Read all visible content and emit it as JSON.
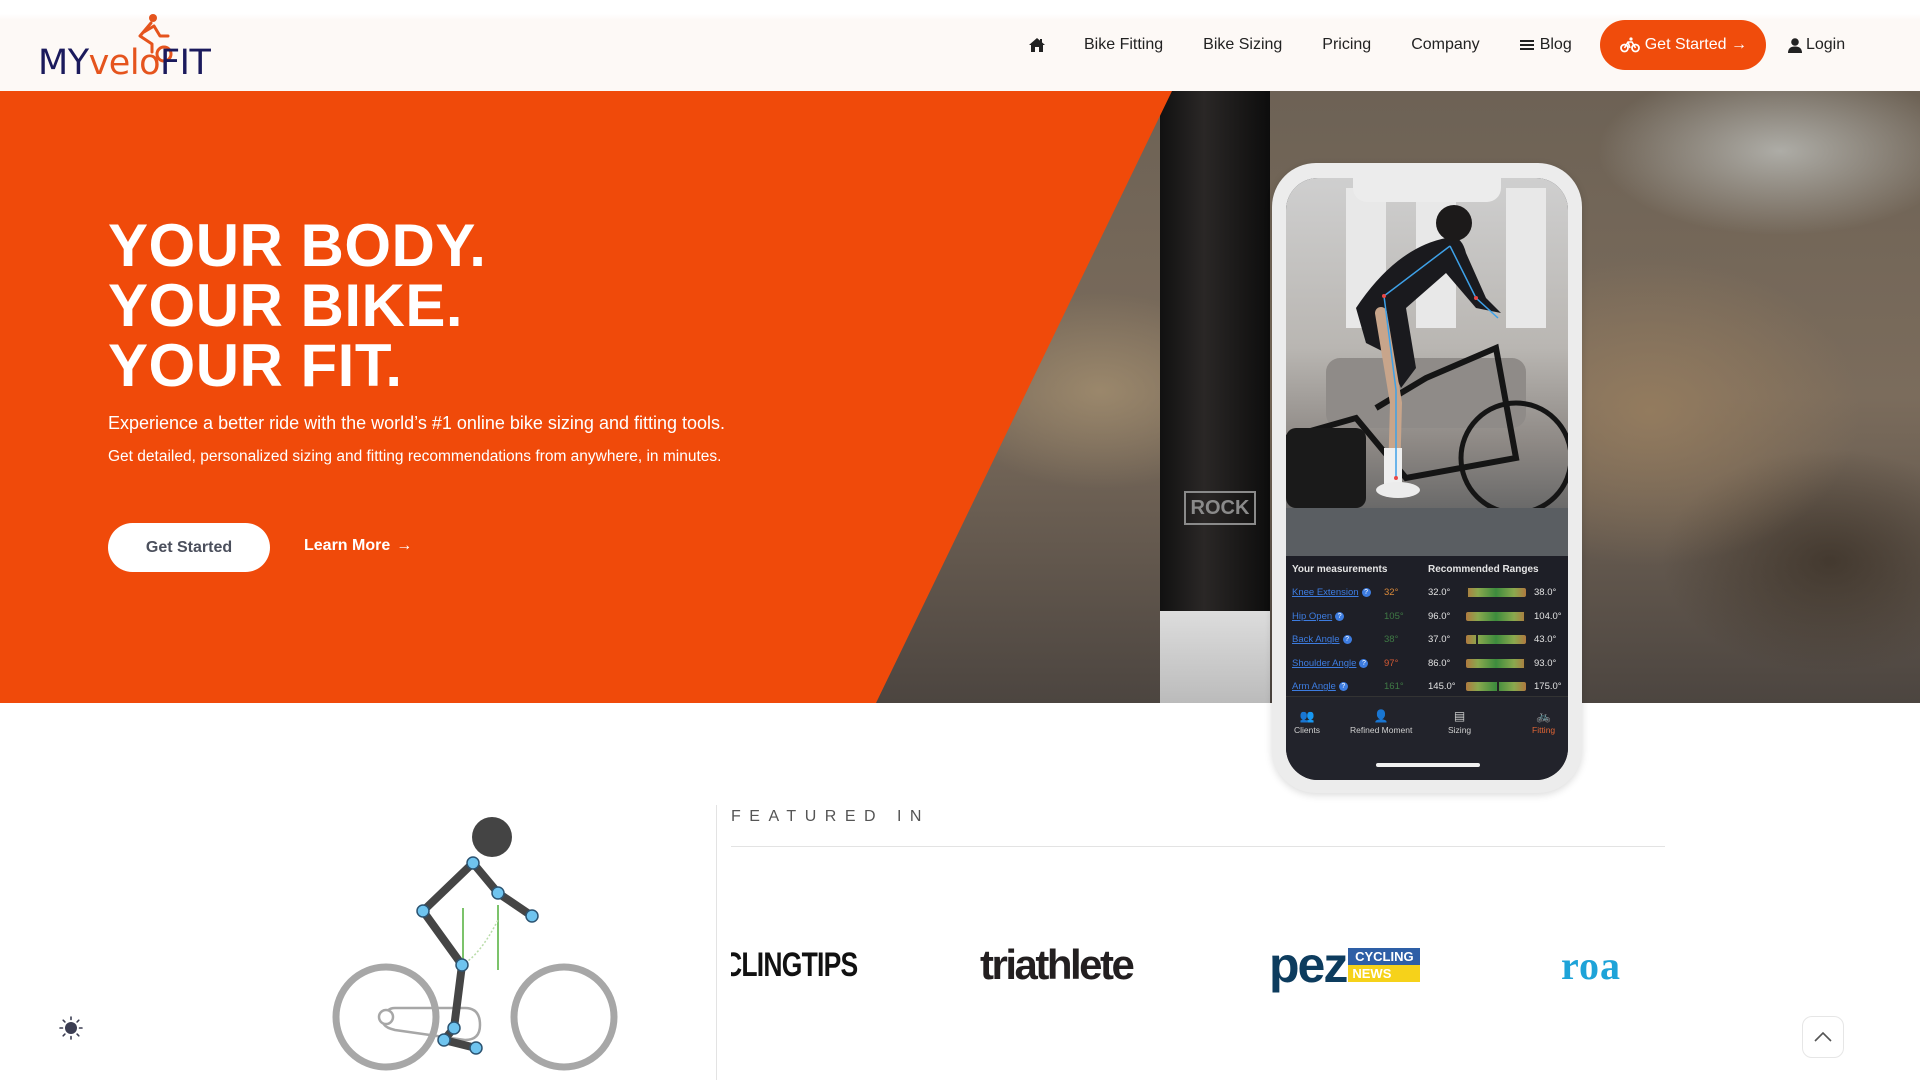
{
  "brand": {
    "name": "MyVeloFit",
    "logo_parts": [
      "MY",
      "VEL",
      "FIT"
    ],
    "accent": "#f04a0a",
    "navy": "#1b1a5c"
  },
  "nav": {
    "home_icon": "home-icon",
    "items": [
      {
        "label": "Bike Fitting"
      },
      {
        "label": "Bike Sizing"
      },
      {
        "label": "Pricing"
      },
      {
        "label": "Company"
      },
      {
        "label": "Blog",
        "icon": "menu-bars-icon"
      }
    ],
    "cta": {
      "label": "Get Started →",
      "icon": "bicycle-icon"
    },
    "login": {
      "label": "Login",
      "icon": "user-icon"
    }
  },
  "hero": {
    "title_lines": [
      "YOUR BODY.",
      "YOUR BIKE.",
      "YOUR FIT."
    ],
    "subtitle": "Experience a better ride with the world’s #1 online bike sizing and fitting tools.",
    "description": "Get detailed, personalized sizing and fitting recommendations from anywhere, in minutes.",
    "primary_button": "Get Started",
    "secondary_link": "Learn More",
    "secondary_arrow": "→",
    "background_label": "ROCK"
  },
  "phone_app": {
    "measurements_header": "Your measurements",
    "ranges_header": "Recommended Ranges",
    "metrics": [
      {
        "name": "Knee Extension",
        "value": "32°",
        "value_color": "#d9893a",
        "min": "32.0°",
        "max": "38.0°",
        "position": 0.0
      },
      {
        "name": "Hip Open",
        "value": "105°",
        "value_color": "#3f7a45",
        "min": "96.0°",
        "max": "104.0°",
        "position": 1.0
      },
      {
        "name": "Back Angle",
        "value": "38°",
        "value_color": "#3f7a45",
        "min": "37.0°",
        "max": "43.0°",
        "position": 0.17
      },
      {
        "name": "Shoulder Angle",
        "value": "97°",
        "value_color": "#d65a35",
        "min": "86.0°",
        "max": "93.0°",
        "position": 1.0
      },
      {
        "name": "Arm Angle",
        "value": "161°",
        "value_color": "#3f7a45",
        "min": "145.0°",
        "max": "175.0°",
        "position": 0.53
      }
    ],
    "tabs": [
      {
        "label": "Clients",
        "icon": "clients-icon"
      },
      {
        "label": "Refined Moment",
        "icon": "person-icon"
      },
      {
        "label": "Sizing",
        "icon": "ruler-icon"
      },
      {
        "label": "Fitting",
        "icon": "bicycle-icon",
        "active": true
      }
    ]
  },
  "featured": {
    "label": "FEATURED IN",
    "logos": [
      {
        "name": "CyclingTips",
        "text": "CLINGTIPS"
      },
      {
        "name": "Triathlete",
        "text": "triathlete"
      },
      {
        "name": "PEZ Cycling News",
        "text": "pez",
        "badge_top": "CYCLING",
        "badge_bottom": "NEWS"
      },
      {
        "name": "Road",
        "text": "roa"
      }
    ]
  },
  "widgets": {
    "theme_toggle_icon": "sun-icon",
    "scroll_top_icon": "chevron-up-icon"
  }
}
